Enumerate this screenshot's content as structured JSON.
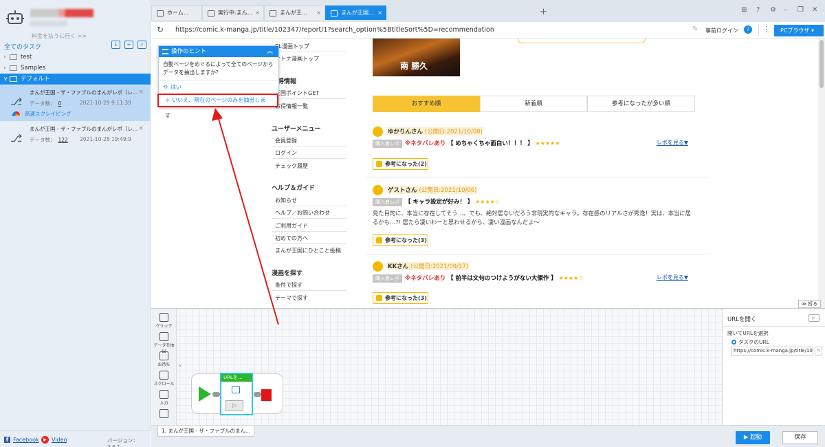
{
  "sidebar": {
    "pay_link": "料金を払うに行く >>",
    "all_tasks": "全てのタスク",
    "folders": [
      {
        "label": "test"
      },
      {
        "label": "Samples"
      },
      {
        "label": "デフォルト"
      }
    ],
    "tasks": [
      {
        "name": "まんが王国 - ザ・ファブルのまんがレポ（レ...",
        "data_label": "データ数：",
        "count": "0",
        "date": "2021-10-29 9:11:39",
        "tag": "高速スクレイピング"
      },
      {
        "name": "まんが王国 - ザ・ファブルのまんがレポ（レ...",
        "data_label": "データ数：",
        "count": "122",
        "date": "2021-10-28 19:49:9"
      }
    ],
    "footer": {
      "facebook": "Facebook",
      "video": "Video",
      "version": "バージョン：3.6.1"
    }
  },
  "tabs": [
    {
      "label": "ホーム..."
    },
    {
      "label": "実行中:まん..."
    },
    {
      "label": "まんが王..."
    },
    {
      "label": "まんが王国..."
    }
  ],
  "address": {
    "url": "https://comic.k-manga.jp/title/102347/report/1?search_option%5BtitleSort%5D=recommendation",
    "prelogin": "事前ログイン",
    "browser": "PCブラウザ"
  },
  "web": {
    "nav_top": [
      "BL漫画トップ",
      "オトナ漫画トップ"
    ],
    "sec1_head": "お得情報",
    "sec1": [
      "王国ポイントGET",
      "お得情報一覧"
    ],
    "user_head": "ユーザーメニュー",
    "user": [
      "会員登録",
      "ログイン",
      "チェック履歴"
    ],
    "help_head": "ヘルプ＆ガイド",
    "help": [
      "お知らせ",
      "ヘルプ／お問い合わせ",
      "ご利用ガイド",
      "初めての方へ",
      "まんが王国にひとこと投稿"
    ],
    "search_head": "漫画を探す",
    "search": [
      "条件で探す",
      "テーマで探す"
    ],
    "banner_name": "南 勝久",
    "sort_tabs": [
      "おすすめ順",
      "新着順",
      "参考になったが多い順"
    ],
    "reviews": [
      {
        "name": "ゆかりんさん",
        "date": "(公開日:2021/10/08)",
        "tag": "購入者レポ",
        "spoiler": "※ネタバレあり",
        "title": "【 めちゃくちゃ面白い！！！ 】",
        "stars": "★★★★★",
        "more": "レポを見る▼",
        "body": "",
        "help": "参考になった(2)"
      },
      {
        "name": "ゲストさん",
        "date": "(公開日:2021/10/06)",
        "tag": "購入者レポ",
        "spoiler": "",
        "title": "【 キャラ設定が好み！ 】",
        "stars": "★★★★☆",
        "more": "",
        "body": "見た目的に、本当に存在してそう…。でも、絶対居ないだろう非現実的なキャラ。存在感のリアルさが秀逸！実は、本当に居るかも…?! 居たら凄いわーと思わせるから、凄い漫画なんだよ〜",
        "help": "参考になった(3)"
      },
      {
        "name": "KKさん",
        "date": "(公開日:2021/09/17)",
        "tag": "購入者レポ",
        "spoiler": "※ネタバレあり",
        "title": "【 前半は文句のつけようがない大傑作 】",
        "stars": "★★★★☆",
        "more": "レポを見る▼",
        "body": "",
        "help": "参考になった(3)"
      }
    ]
  },
  "hint": {
    "title": "操作のヒント",
    "question": "自動ページをめぐるによって全てのページからデータを抽出しますか？",
    "yes": "はい",
    "no": "いいえ、現在のページのみを抽出しま",
    "tail": "す"
  },
  "designer": {
    "tools": [
      "クリック",
      "データを抽出",
      "お待ち",
      "スクロール",
      "入力",
      ""
    ],
    "node_label": "URLを...",
    "fold": "折る",
    "bottom_tab": "1. まんが王国 - ザ・ファブルのまん..."
  },
  "panel": {
    "title": "URLを開く",
    "label": "開いてURLを選択",
    "option": "タスクのURL",
    "url": "https://comic.k-manga.jp/title/1023"
  },
  "actions": {
    "start": "起動",
    "save": "保存"
  }
}
